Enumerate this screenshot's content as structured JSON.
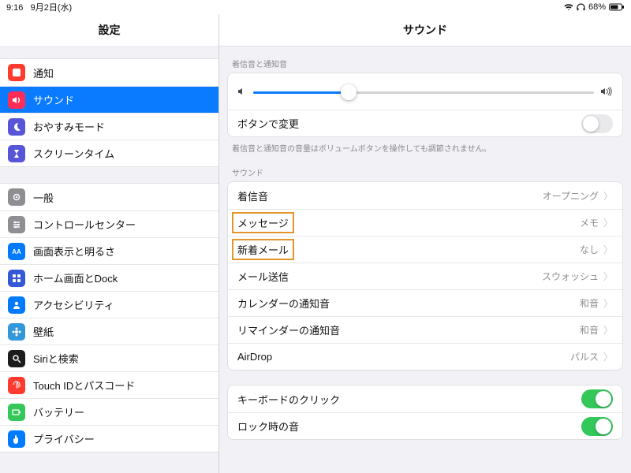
{
  "statusbar": {
    "time": "9:16",
    "date": "9月2日(水)",
    "battery": "68%"
  },
  "sidebar_title": "設定",
  "groups": [
    [
      {
        "icon": "bell",
        "color": "c-red",
        "label": "通知"
      },
      {
        "icon": "speaker",
        "color": "c-pink",
        "label": "サウンド",
        "active": true
      },
      {
        "icon": "moon",
        "color": "c-indigo",
        "label": "おやすみモード"
      },
      {
        "icon": "hourglass",
        "color": "c-indigo",
        "label": "スクリーンタイム"
      }
    ],
    [
      {
        "icon": "gear",
        "color": "c-gray",
        "label": "一般"
      },
      {
        "icon": "sliders",
        "color": "c-gray",
        "label": "コントロールセンター"
      },
      {
        "icon": "aa",
        "color": "c-blue",
        "label": "画面表示と明るさ"
      },
      {
        "icon": "grid",
        "color": "c-deepblue",
        "label": "ホーム画面とDock"
      },
      {
        "icon": "person",
        "color": "c-blue",
        "label": "アクセシビリティ"
      },
      {
        "icon": "flower",
        "color": "c-cyan",
        "label": "壁紙"
      },
      {
        "icon": "search",
        "color": "c-black",
        "label": "Siriと検索"
      },
      {
        "icon": "finger",
        "color": "c-red",
        "label": "Touch IDとパスコード"
      },
      {
        "icon": "battery",
        "color": "c-green",
        "label": "バッテリー"
      },
      {
        "icon": "hand",
        "color": "c-blue",
        "label": "プライバシー"
      }
    ]
  ],
  "detail_title": "サウンド",
  "ring": {
    "caption": "着信音と通知音",
    "level_pct": 28,
    "change_with_buttons": "ボタンで変更",
    "change_with_buttons_on": false,
    "footer": "着信音と通知音の音量はボリュームボタンを操作しても調節されません。"
  },
  "sounds_caption": "サウンド",
  "sounds": [
    {
      "label": "着信音",
      "value": "オープニング"
    },
    {
      "label": "メッセージ",
      "value": "メモ",
      "highlight": true
    },
    {
      "label": "新着メール",
      "value": "なし",
      "highlight": true
    },
    {
      "label": "メール送信",
      "value": "スウォッシュ"
    },
    {
      "label": "カレンダーの通知音",
      "value": "和音"
    },
    {
      "label": "リマインダーの通知音",
      "value": "和音"
    },
    {
      "label": "AirDrop",
      "value": "パルス"
    }
  ],
  "toggles": [
    {
      "label": "キーボードのクリック",
      "on": true
    },
    {
      "label": "ロック時の音",
      "on": true
    }
  ]
}
